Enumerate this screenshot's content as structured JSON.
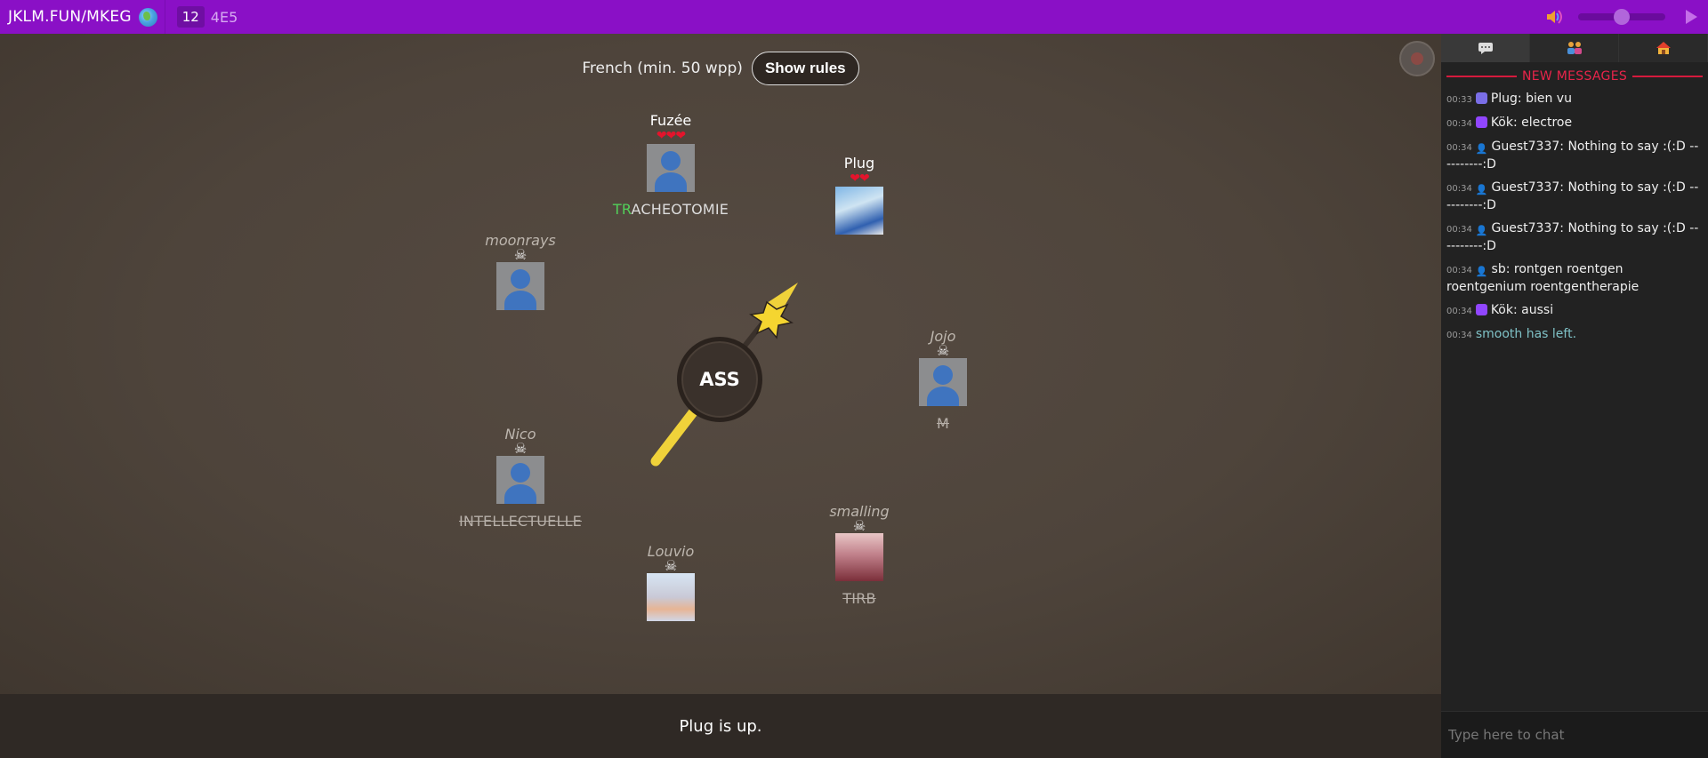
{
  "topbar": {
    "room_link": "JKLM.FUN/MKEG",
    "player_count": "12",
    "round_code": "4E5",
    "volume_level": 0.5
  },
  "game": {
    "language_label": "French (min. 50 wpp)",
    "show_rules_label": "Show rules",
    "syllable": "ASS",
    "players": [
      {
        "name": "Fuzée",
        "alive": true,
        "lives": 3,
        "word_prefix": "TR",
        "word_rest": "ACHEOTOMIE",
        "avatar": "default"
      },
      {
        "name": "Plug",
        "alive": true,
        "lives": 2,
        "word_prefix": "",
        "word_rest": "",
        "avatar": "plug"
      },
      {
        "name": "moonrays",
        "alive": false,
        "lives": 0,
        "word_prefix": "",
        "word_rest": "",
        "avatar": "default"
      },
      {
        "name": "Jojo",
        "alive": false,
        "lives": 0,
        "word_prefix": "",
        "word_rest": "M",
        "avatar": "default"
      },
      {
        "name": "Nico",
        "alive": false,
        "lives": 0,
        "word_prefix": "",
        "word_rest": "INTELLECTUELLE",
        "avatar": "default"
      },
      {
        "name": "smalling",
        "alive": false,
        "lives": 0,
        "word_prefix": "",
        "word_rest": "TIRB",
        "avatar": "smalling"
      },
      {
        "name": "Louvio",
        "alive": false,
        "lives": 0,
        "word_prefix": "",
        "word_rest": "",
        "avatar": "louvio"
      }
    ],
    "heart_glyph": "❤",
    "skull_glyph": "☠",
    "status_text": "Plug is up."
  },
  "chat": {
    "new_messages_label": "NEW MESSAGES",
    "input_placeholder": "Type here to chat",
    "tabs": [
      "chat-icon",
      "players-icon",
      "home-icon"
    ],
    "messages": [
      {
        "time": "00:33",
        "badge": "discord",
        "author": "Plug",
        "text": "bien vu"
      },
      {
        "time": "00:34",
        "badge": "twitch",
        "author": "Kök",
        "text": "electroe"
      },
      {
        "time": "00:34",
        "badge": "guest",
        "author": "Guest7337",
        "text": "Nothing to say :(:D ----------:D"
      },
      {
        "time": "00:34",
        "badge": "guest",
        "author": "Guest7337",
        "text": "Nothing to say :(:D ----------:D"
      },
      {
        "time": "00:34",
        "badge": "guest",
        "author": "Guest7337",
        "text": "Nothing to say :(:D ----------:D"
      },
      {
        "time": "00:34",
        "badge": "guest",
        "author": "sb",
        "text": "rontgen roentgen roentgenium roentgentherapie"
      },
      {
        "time": "00:34",
        "badge": "twitch",
        "author": "Kök",
        "text": "aussi"
      },
      {
        "time": "00:34",
        "badge": "system",
        "author": "",
        "text": "smooth has left."
      }
    ]
  },
  "colors": {
    "topbar": "#8a10c6",
    "heart": "#e4142c",
    "highlight": "#52d05a",
    "new_messages": "#e8244a"
  }
}
